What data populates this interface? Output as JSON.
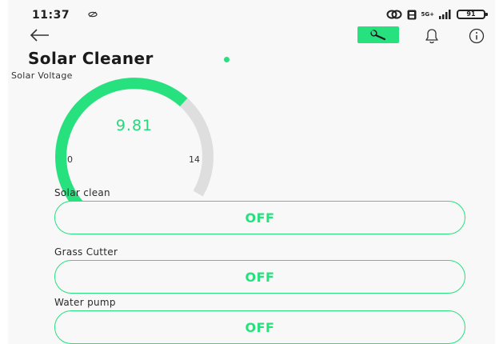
{
  "status_bar": {
    "time": "11:37",
    "network": "5G+",
    "battery": "91"
  },
  "header": {
    "back_icon": "arrow-left-icon",
    "tools_icon": "wrench-icon",
    "notification_icon": "bell-icon",
    "info_icon": "info-icon"
  },
  "device": {
    "name": "Solar Cleaner",
    "status_color": "#27e07e"
  },
  "gauge": {
    "label": "Solar Voltage",
    "value": "9.81",
    "min": "0",
    "max": "14",
    "value_num": 9.81,
    "min_num": 0,
    "max_num": 14,
    "active_color": "#27e07e",
    "track_color": "#dedede"
  },
  "switches": [
    {
      "label": "Solar clean",
      "state": "OFF"
    },
    {
      "label": "Grass Cutter",
      "state": "OFF"
    },
    {
      "label": "Water pump",
      "state": "OFF"
    }
  ],
  "colors": {
    "accent": "#27e07e",
    "background": "#f8f8f8"
  }
}
